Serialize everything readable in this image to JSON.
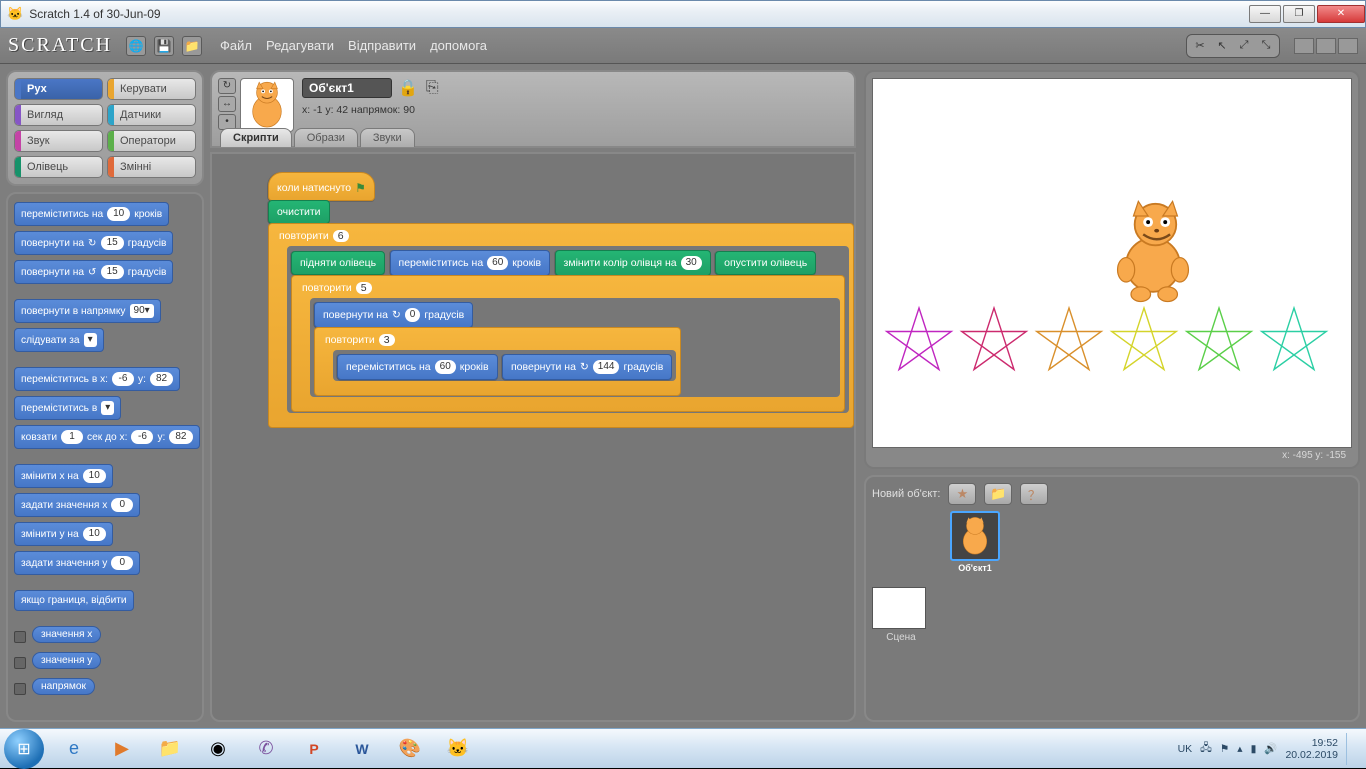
{
  "window": {
    "title": "Scratch 1.4 of 30-Jun-09"
  },
  "toolbar": {
    "logo": "SCRATCH",
    "menus": [
      "Файл",
      "Редагувати",
      "Відправити",
      "допомога"
    ]
  },
  "categories": [
    {
      "label": "Рух",
      "color": "#4a76c6",
      "active": true
    },
    {
      "label": "Керувати",
      "color": "#e9a52f",
      "active": false
    },
    {
      "label": "Вигляд",
      "color": "#8656c6",
      "active": false
    },
    {
      "label": "Датчики",
      "color": "#2ca4c9",
      "active": false
    },
    {
      "label": "Звук",
      "color": "#c443a6",
      "active": false
    },
    {
      "label": "Оператори",
      "color": "#5cb04a",
      "active": false
    },
    {
      "label": "Олівець",
      "color": "#17926a",
      "active": false
    },
    {
      "label": "Змінні",
      "color": "#e06a3a",
      "active": false
    }
  ],
  "palette": {
    "move_steps": {
      "pre": "переміститись на",
      "val": "10",
      "post": "кроків"
    },
    "turn_cw": {
      "pre": "повернути на",
      "val": "15",
      "post": "градусів",
      "icon": "↻"
    },
    "turn_ccw": {
      "pre": "повернути на",
      "val": "15",
      "post": "градусів",
      "icon": "↺"
    },
    "point_dir": {
      "pre": "повернути в напрямку",
      "val": "90▾"
    },
    "point_towards": {
      "pre": "слідувати за",
      "val": "▾"
    },
    "goto_xy": {
      "pre": "переміститись в x:",
      "x": "-6",
      "mid": "y:",
      "y": "82"
    },
    "goto": {
      "pre": "переміститись в",
      "val": "▾"
    },
    "glide": {
      "pre": "ковзати",
      "sec": "1",
      "mid1": "сек до x:",
      "x": "-6",
      "mid2": "y:",
      "y": "82"
    },
    "change_x": {
      "pre": "змінити x на",
      "val": "10"
    },
    "set_x": {
      "pre": "задати значення x",
      "val": "0"
    },
    "change_y": {
      "pre": "змінити y на",
      "val": "10"
    },
    "set_y": {
      "pre": "задати значення y",
      "val": "0"
    },
    "bounce": {
      "pre": "якщо границя, відбити"
    },
    "reporters": [
      "значення x",
      "значення y",
      "напрямок"
    ]
  },
  "sprite_header": {
    "name": "Об'єкт1",
    "coords": "x: -1    y: 42    напрямок:  90",
    "tabs": [
      "Скрипти",
      "Образи",
      "Звуки"
    ]
  },
  "script": {
    "when_flag": "коли натиснуто",
    "clear": "очистити",
    "repeat1": {
      "label": "повторити",
      "val": "6"
    },
    "pen_up": "підняти олівець",
    "move60": {
      "pre": "переміститись на",
      "val": "60",
      "post": "кроків"
    },
    "change_pen_color": {
      "pre": "змінити колір олівця на",
      "val": "30"
    },
    "pen_down": "опустити олівець",
    "repeat2": {
      "label": "повторити",
      "val": "5"
    },
    "turn0": {
      "pre": "повернути на",
      "icon": "↻",
      "val": "0",
      "post": "градусів"
    },
    "repeat3": {
      "label": "повторити",
      "val": "3"
    },
    "move60b": {
      "pre": "переміститись на",
      "val": "60",
      "post": "кроків"
    },
    "turn144": {
      "pre": "повернути на",
      "icon": "↻",
      "val": "144",
      "post": "градусів"
    }
  },
  "stage": {
    "mouse_readout": "x: -495   y: -155",
    "star_colors": [
      "#c026c0",
      "#cc2a6e",
      "#d9902c",
      "#d4d42a",
      "#5bcf49",
      "#2bcfa4"
    ]
  },
  "sprite_list": {
    "title": "Новий об'єкт:",
    "stage_label": "Сцена",
    "selected_sprite": "Об'єкт1"
  },
  "taskbar": {
    "lang": "UK",
    "time": "19:52",
    "date": "20.02.2019"
  }
}
